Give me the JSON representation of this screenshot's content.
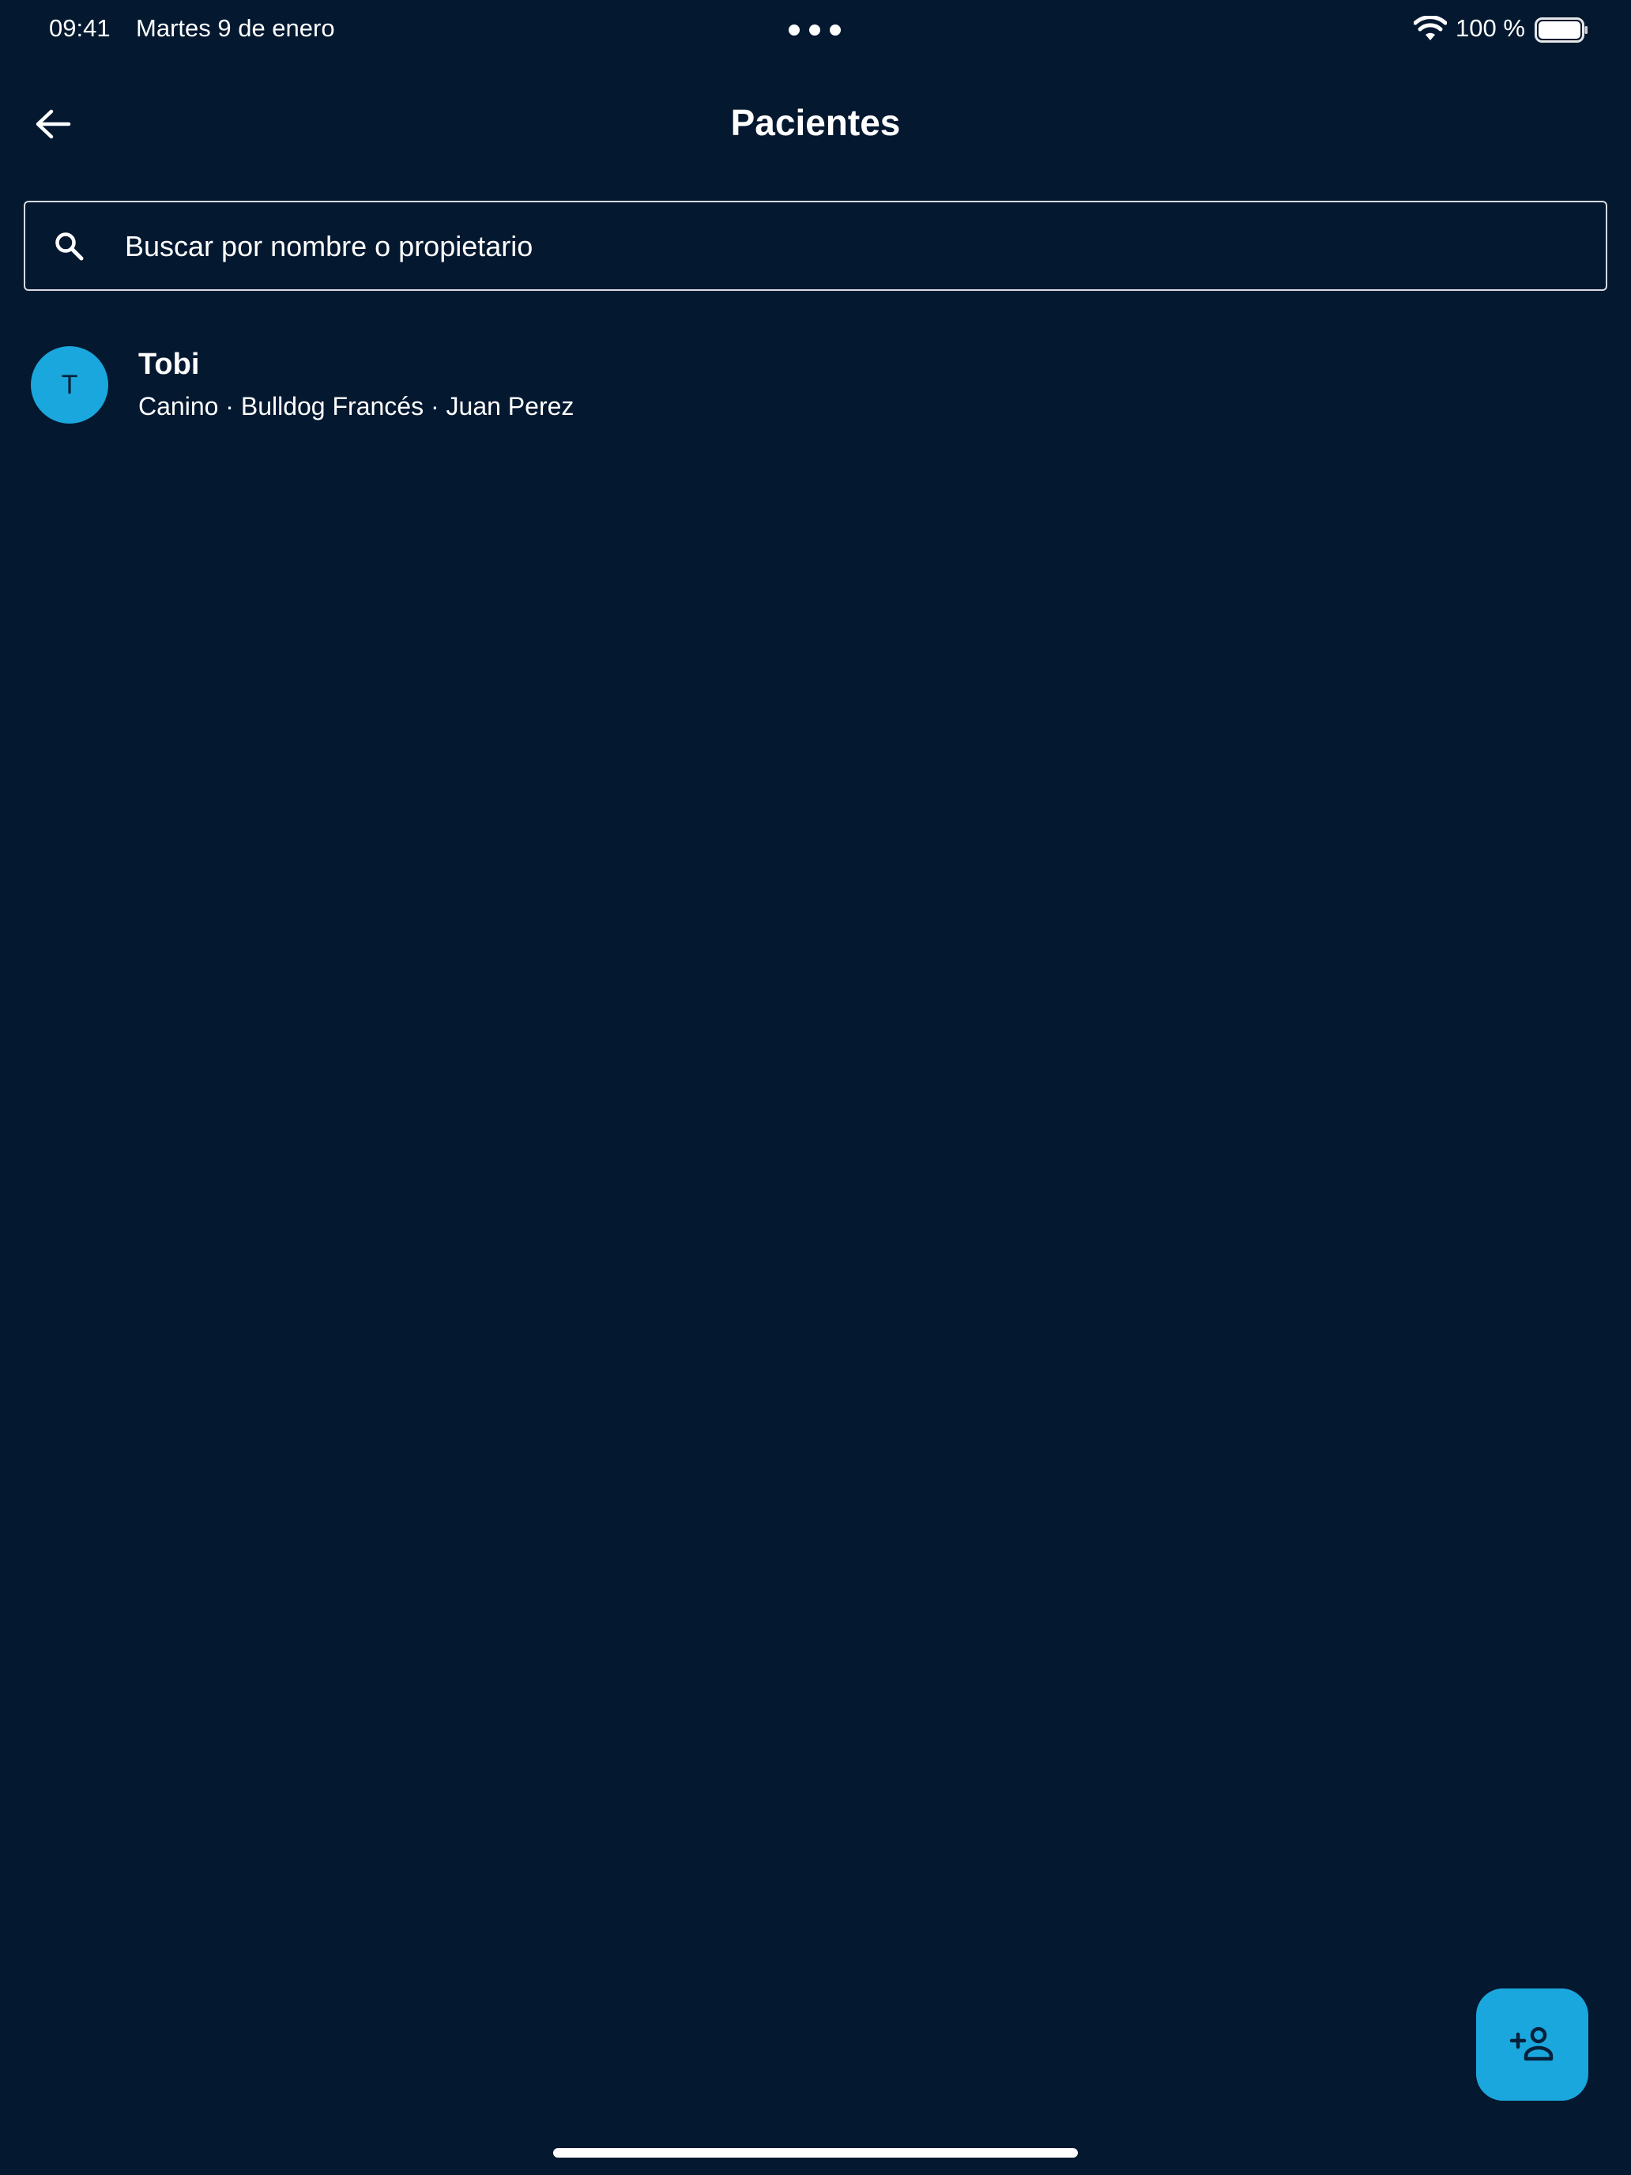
{
  "status_bar": {
    "time": "09:41",
    "date": "Martes 9 de enero",
    "battery_percent": "100 %",
    "battery_level": 1.0,
    "icons": [
      "wifi-icon",
      "battery-icon",
      "multitask-dots-icon"
    ]
  },
  "header": {
    "title": "Pacientes",
    "back_icon": "arrow-left-icon"
  },
  "search": {
    "placeholder": "Buscar por nombre o propietario",
    "value": "",
    "icon": "search-icon"
  },
  "patients": [
    {
      "initial": "T",
      "name": "Tobi",
      "details": "Canino · Bulldog Francés · Juan Perez"
    }
  ],
  "fab": {
    "icon": "person-add-icon"
  },
  "colors": {
    "background": "#041830",
    "accent": "#1aa7dd",
    "text": "#ffffff",
    "border": "#d6dbe3"
  }
}
